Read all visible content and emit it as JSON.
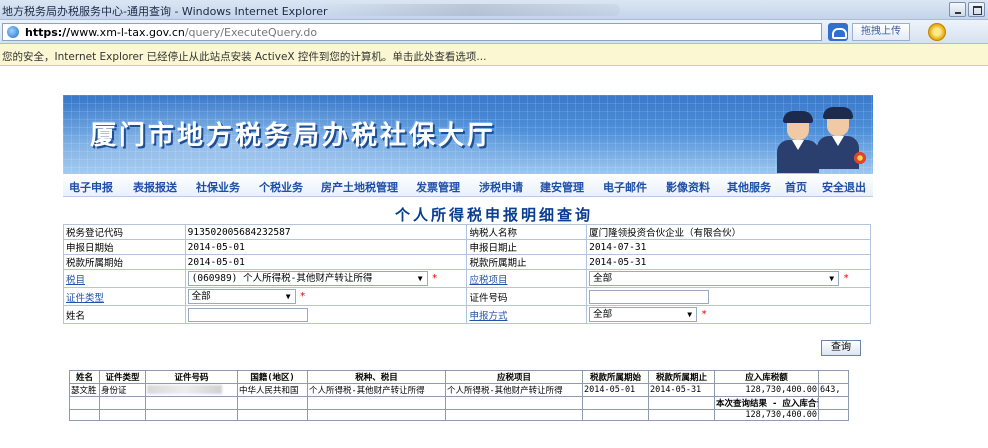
{
  "window": {
    "title": "地方税务局办税服务中心-通用查询 - Windows Internet Explorer"
  },
  "address": {
    "url_prefix": "https://",
    "url_host": "www.xm-l-tax.gov.cn",
    "url_path": "/query/ExecuteQuery.do",
    "upload_label": "拖拽上传"
  },
  "infobar": {
    "text": "您的安全，Internet Explorer 已经停止从此站点安装 ActiveX 控件到您的计算机。单击此处查看选项..."
  },
  "banner": {
    "title": "厦门市地方税务局办税社保大厅"
  },
  "nav": {
    "items": [
      "电子申报",
      "表报报送",
      "社保业务",
      "个税业务",
      "房产土地税管理",
      "发票管理",
      "涉税申请",
      "建安管理",
      "电子邮件",
      "影像资料",
      "其他服务",
      "首页",
      "安全退出"
    ]
  },
  "page_title": "个人所得税申报明细查询",
  "form": {
    "r1": {
      "l1": "税务登记代码",
      "v1": "913502005684232587",
      "l2": "纳税人名称",
      "v2": "厦门隆领投资合伙企业（有限合伙）"
    },
    "r2": {
      "l1": "申报日期始",
      "v1": "2014-05-01",
      "l2": "申报日期止",
      "v2": "2014-07-31"
    },
    "r3": {
      "l1": "税款所属期始",
      "v1": "2014-05-01",
      "l2": "税款所属期止",
      "v2": "2014-05-31"
    },
    "r4": {
      "l1": "税目",
      "v1": "(060989) 个人所得税-其他财产转让所得",
      "l2": "应税项目",
      "v2": "全部"
    },
    "r5": {
      "l1": "证件类型",
      "v1": "全部",
      "l2": "证件号码",
      "v2": ""
    },
    "r6": {
      "l1": "姓名",
      "v1": "",
      "l2": "申报方式",
      "v2": "全部"
    },
    "required_mark": "*",
    "query_button": "查询"
  },
  "result": {
    "headers": [
      "姓名",
      "证件类型",
      "证件号码",
      "国籍(地区)",
      "税种、税目",
      "应税项目",
      "税款所属期始",
      "税款所属期止",
      "应入库税额"
    ],
    "rows": [
      [
        "瑟文胜",
        "身份证",
        "",
        "中华人民共和国",
        "个人所得税-其他财产转让所得",
        "个人所得税-其他财产转让所得",
        "2014-05-01",
        "2014-05-31",
        "128,730,400.00",
        "643,"
      ]
    ],
    "summary_label": "本次查询结果 - 应入库合计",
    "summary_value": "128,730,400.00"
  }
}
